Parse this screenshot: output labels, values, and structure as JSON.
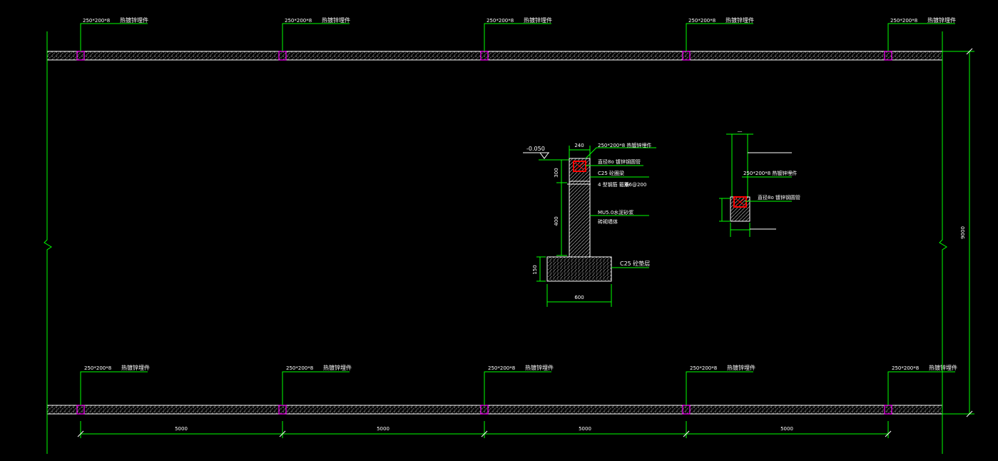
{
  "colors": {
    "background": "#000000",
    "dimension_line": "#00ff00",
    "outline": "#ffffff",
    "embed_plate": "#ff00ff",
    "section_steel": "#ff0000"
  },
  "embed_label": {
    "size": "250*200*8",
    "name": "热镀锌埋件"
  },
  "top_wall": {
    "labels": [
      {
        "size": "250*200*8",
        "name": "热镀锌埋件"
      },
      {
        "size": "250*200*8",
        "name": "热镀锌埋件"
      },
      {
        "size": "250*200*8",
        "name": "热镀锌埋件"
      },
      {
        "size": "250*200*8",
        "name": "热镀锌埋件"
      },
      {
        "size": "250*200*8",
        "name": "热镀锌埋件"
      }
    ]
  },
  "bottom_wall": {
    "labels": [
      {
        "size": "250*200*8",
        "name": "热镀锌埋件"
      },
      {
        "size": "250*200*8",
        "name": "热镀锌埋件"
      },
      {
        "size": "250*200*8",
        "name": "热镀锌埋件"
      },
      {
        "size": "250*200*8",
        "name": "热镀锌埋件"
      },
      {
        "size": "250*200*8",
        "name": "热镀锌埋件"
      }
    ]
  },
  "spans": [
    "5000",
    "5000",
    "5000",
    "5000"
  ],
  "overall_width": "9000",
  "section": {
    "level": "-0.050",
    "width_top": "240",
    "beam_height": "300",
    "wall_height": "400",
    "footing_height": "150",
    "footing_width": "600",
    "callouts": [
      "250*200*8  热镀锌埋件",
      "直径8o  镀锌钢圆管",
      "C25 砼圈梁",
      "4 型钢筋 箍筋",
      "Φ6@200",
      "MU5.0水泥砂浆",
      "砖砌墙体",
      "C25 砼垫层"
    ]
  },
  "detail": {
    "callouts": [
      "—",
      "250*200*8  热镀锌埋件",
      "直径8o  镀锌钢圆管"
    ]
  }
}
